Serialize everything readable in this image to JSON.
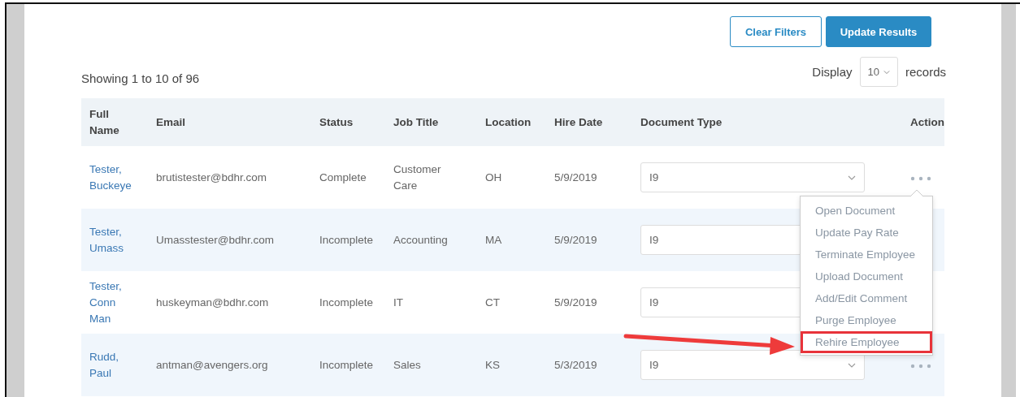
{
  "toolbar": {
    "buttons": [
      {
        "label": "Clear Filters",
        "kind": "outline"
      },
      {
        "label": "Update Results",
        "kind": "primary"
      }
    ]
  },
  "summary": "Showing 1 to 10 of 96",
  "page_size": {
    "before": "Display",
    "value": "10",
    "after": "records"
  },
  "table": {
    "columns": [
      "Full Name",
      "Email",
      "Status",
      "Job Title",
      "Location",
      "Hire Date",
      "Document Type",
      "Action"
    ],
    "rows": [
      {
        "name": "Tester, Buckeye",
        "email": "brutistester@bdhr.com",
        "status": "Complete",
        "job_title": "Customer Care",
        "location": "OH",
        "hire_date": "5/9/2019",
        "document_type": "I9",
        "actions_button": true
      },
      {
        "name": "Tester, Umass",
        "email": "Umasstester@bdhr.com",
        "status": "Incomplete",
        "job_title": "Accounting",
        "location": "MA",
        "hire_date": "5/9/2019",
        "document_type": "I9",
        "actions_button": false
      },
      {
        "name": "Tester, Conn Man",
        "email": "huskeyman@bdhr.com",
        "status": "Incomplete",
        "job_title": "IT",
        "location": "CT",
        "hire_date": "5/9/2019",
        "document_type": "I9",
        "actions_button": false
      },
      {
        "name": "Rudd, Paul",
        "email": "antman@avengers.org",
        "status": "Incomplete",
        "job_title": "Sales",
        "location": "KS",
        "hire_date": "5/3/2019",
        "document_type": "I9",
        "actions_button": true
      }
    ]
  },
  "action_menu": {
    "items": [
      {
        "label": "Open Document",
        "annotated": false
      },
      {
        "label": "Update Pay Rate",
        "annotated": false
      },
      {
        "label": "Terminate Employee",
        "annotated": false
      },
      {
        "label": "Upload Document",
        "annotated": false
      },
      {
        "label": "Add/Edit Comment",
        "annotated": false
      },
      {
        "label": "Purge Employee",
        "annotated": false
      },
      {
        "label": "Rehire Employee",
        "annotated": true
      }
    ]
  }
}
